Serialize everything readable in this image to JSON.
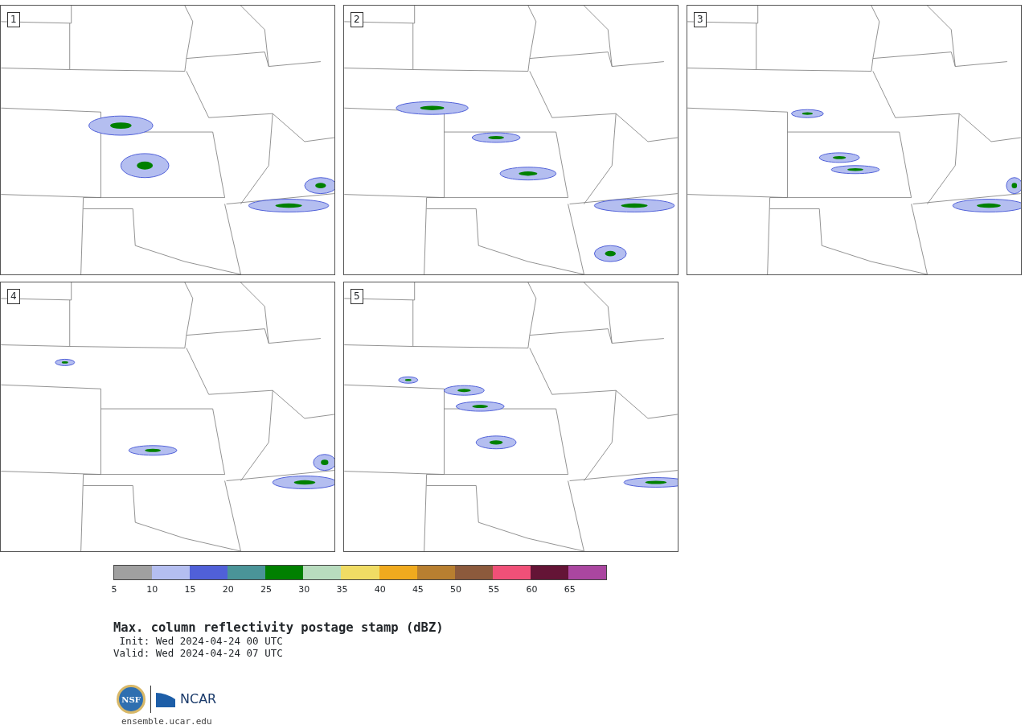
{
  "panels": [
    {
      "label": "1"
    },
    {
      "label": "2"
    },
    {
      "label": "3"
    },
    {
      "label": "4"
    },
    {
      "label": "5"
    }
  ],
  "colorbar": {
    "segments": [
      {
        "color": "#a0a0a0"
      },
      {
        "color": "#b4bef0"
      },
      {
        "color": "#5060d8"
      },
      {
        "color": "#4a9498"
      },
      {
        "color": "#008000"
      },
      {
        "color": "#b8dcbe"
      },
      {
        "color": "#f0dc64"
      },
      {
        "color": "#f0aa1e"
      },
      {
        "color": "#b87f30"
      },
      {
        "color": "#8c5a3c"
      },
      {
        "color": "#f05078"
      },
      {
        "color": "#641436"
      },
      {
        "color": "#aa46a0"
      }
    ],
    "ticks": [
      "5",
      "10",
      "15",
      "20",
      "25",
      "30",
      "35",
      "40",
      "45",
      "50",
      "55",
      "60",
      "65"
    ]
  },
  "title": "Max. column reflectivity postage stamp (dBZ)",
  "init": " Init: Wed 2024-04-24 00 UTC",
  "valid": "Valid: Wed 2024-04-24 07 UTC",
  "logos": {
    "nsf": "NSF",
    "ncar": "NCAR"
  },
  "site": "ensemble.ucar.edu"
}
